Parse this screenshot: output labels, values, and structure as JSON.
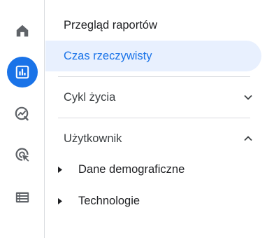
{
  "colors": {
    "accent": "#1a73e8",
    "active_bg": "#e8f0fe",
    "icon": "#5f6368"
  },
  "rail": {
    "items": [
      {
        "icon": "home-icon",
        "active": false
      },
      {
        "icon": "reports-icon",
        "active": true
      },
      {
        "icon": "explore-icon",
        "active": false
      },
      {
        "icon": "advertising-icon",
        "active": false
      },
      {
        "icon": "configure-icon",
        "active": false
      }
    ]
  },
  "panel": {
    "overview_label": "Przegląd raportów",
    "active_label": "Czas rzeczywisty",
    "sections": [
      {
        "label": "Cykl życia",
        "expanded": false,
        "chevron": "chevron-down-icon",
        "items": []
      },
      {
        "label": "Użytkownik",
        "expanded": true,
        "chevron": "chevron-up-icon",
        "items": [
          {
            "label": "Dane demograficzne",
            "icon": "expand-arrow-icon"
          },
          {
            "label": "Technologie",
            "icon": "expand-arrow-icon"
          }
        ]
      }
    ]
  }
}
